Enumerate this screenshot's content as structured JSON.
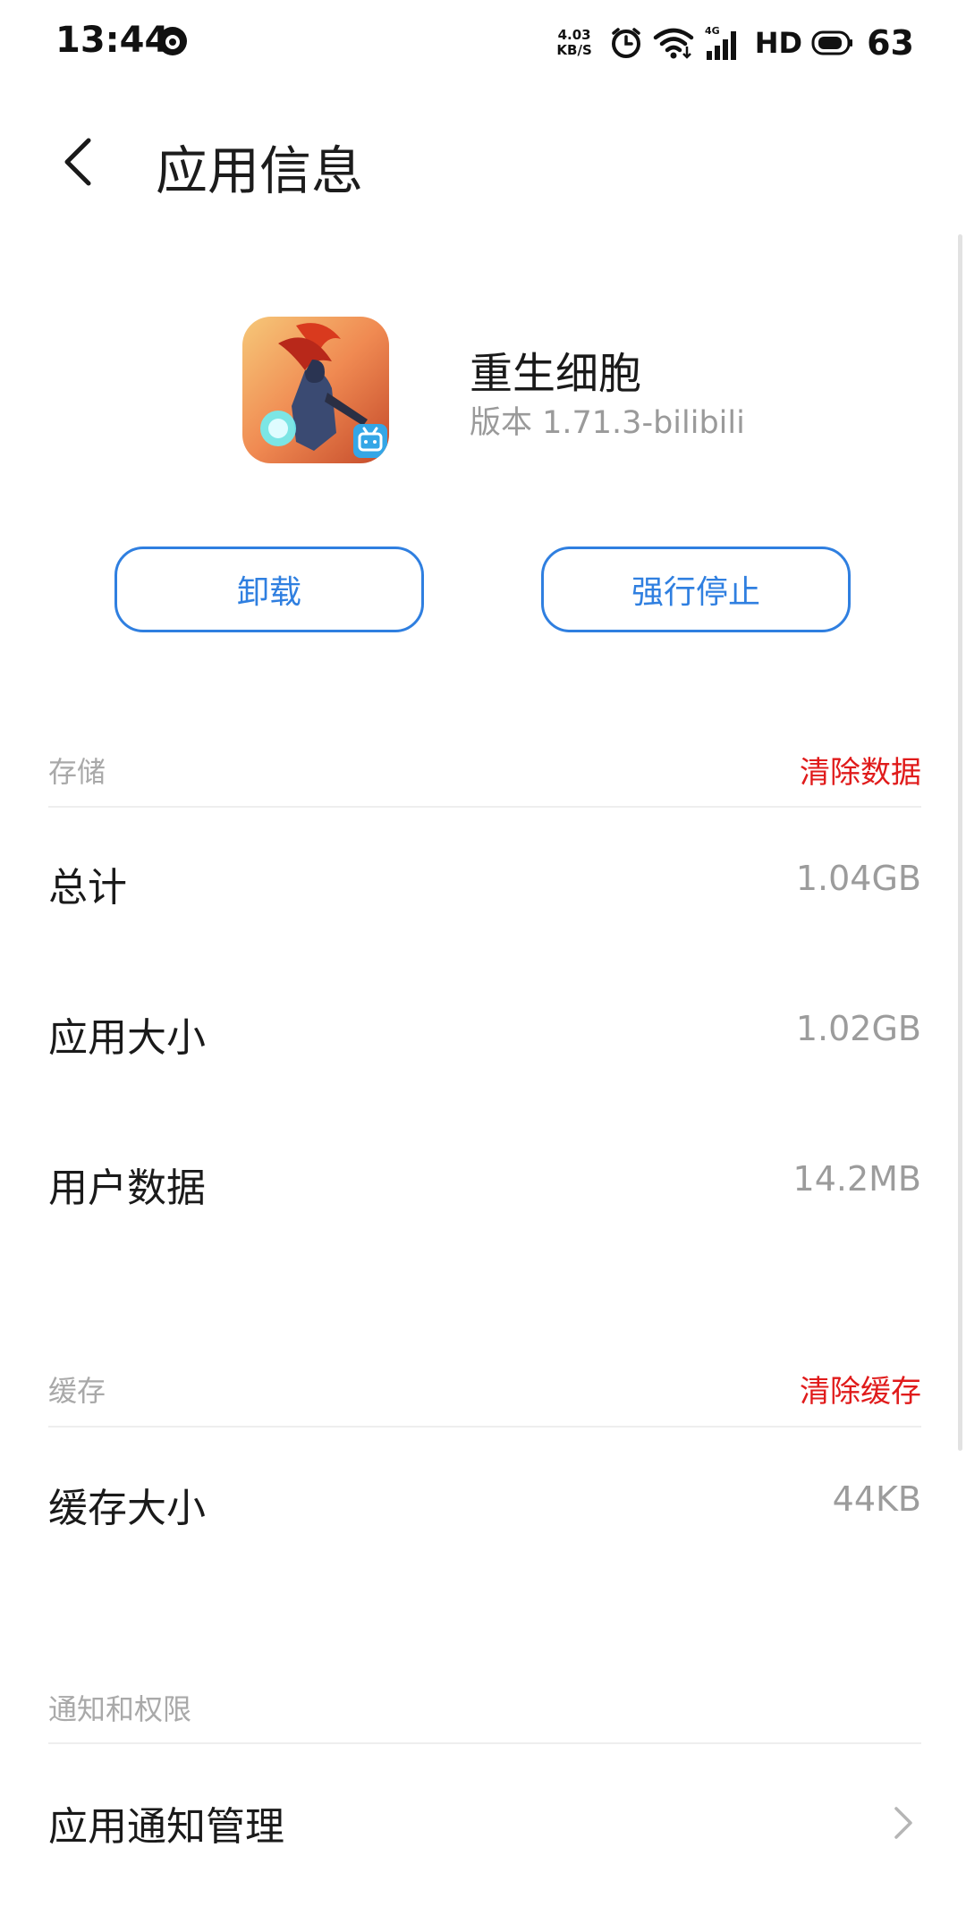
{
  "status_bar": {
    "time": "13:44",
    "net_speed_value": "4.03",
    "net_speed_unit": "KB/S",
    "network_type": "4G",
    "hd": "HD",
    "battery": "63"
  },
  "header": {
    "title": "应用信息"
  },
  "app": {
    "name": "重生细胞",
    "version": "版本 1.71.3-bilibili"
  },
  "actions": {
    "uninstall": "卸载",
    "force_stop": "强行停止"
  },
  "storage": {
    "header": "存储",
    "clear_action": "清除数据",
    "rows": [
      {
        "label": "总计",
        "value": "1.04GB"
      },
      {
        "label": "应用大小",
        "value": "1.02GB"
      },
      {
        "label": "用户数据",
        "value": "14.2MB"
      }
    ]
  },
  "cache": {
    "header": "缓存",
    "clear_action": "清除缓存",
    "rows": [
      {
        "label": "缓存大小",
        "value": "44KB"
      }
    ]
  },
  "notifications": {
    "header": "通知和权限",
    "rows": [
      {
        "label": "应用通知管理"
      }
    ]
  },
  "colors": {
    "accent": "#2f7fe0",
    "danger": "#e01b1b"
  }
}
